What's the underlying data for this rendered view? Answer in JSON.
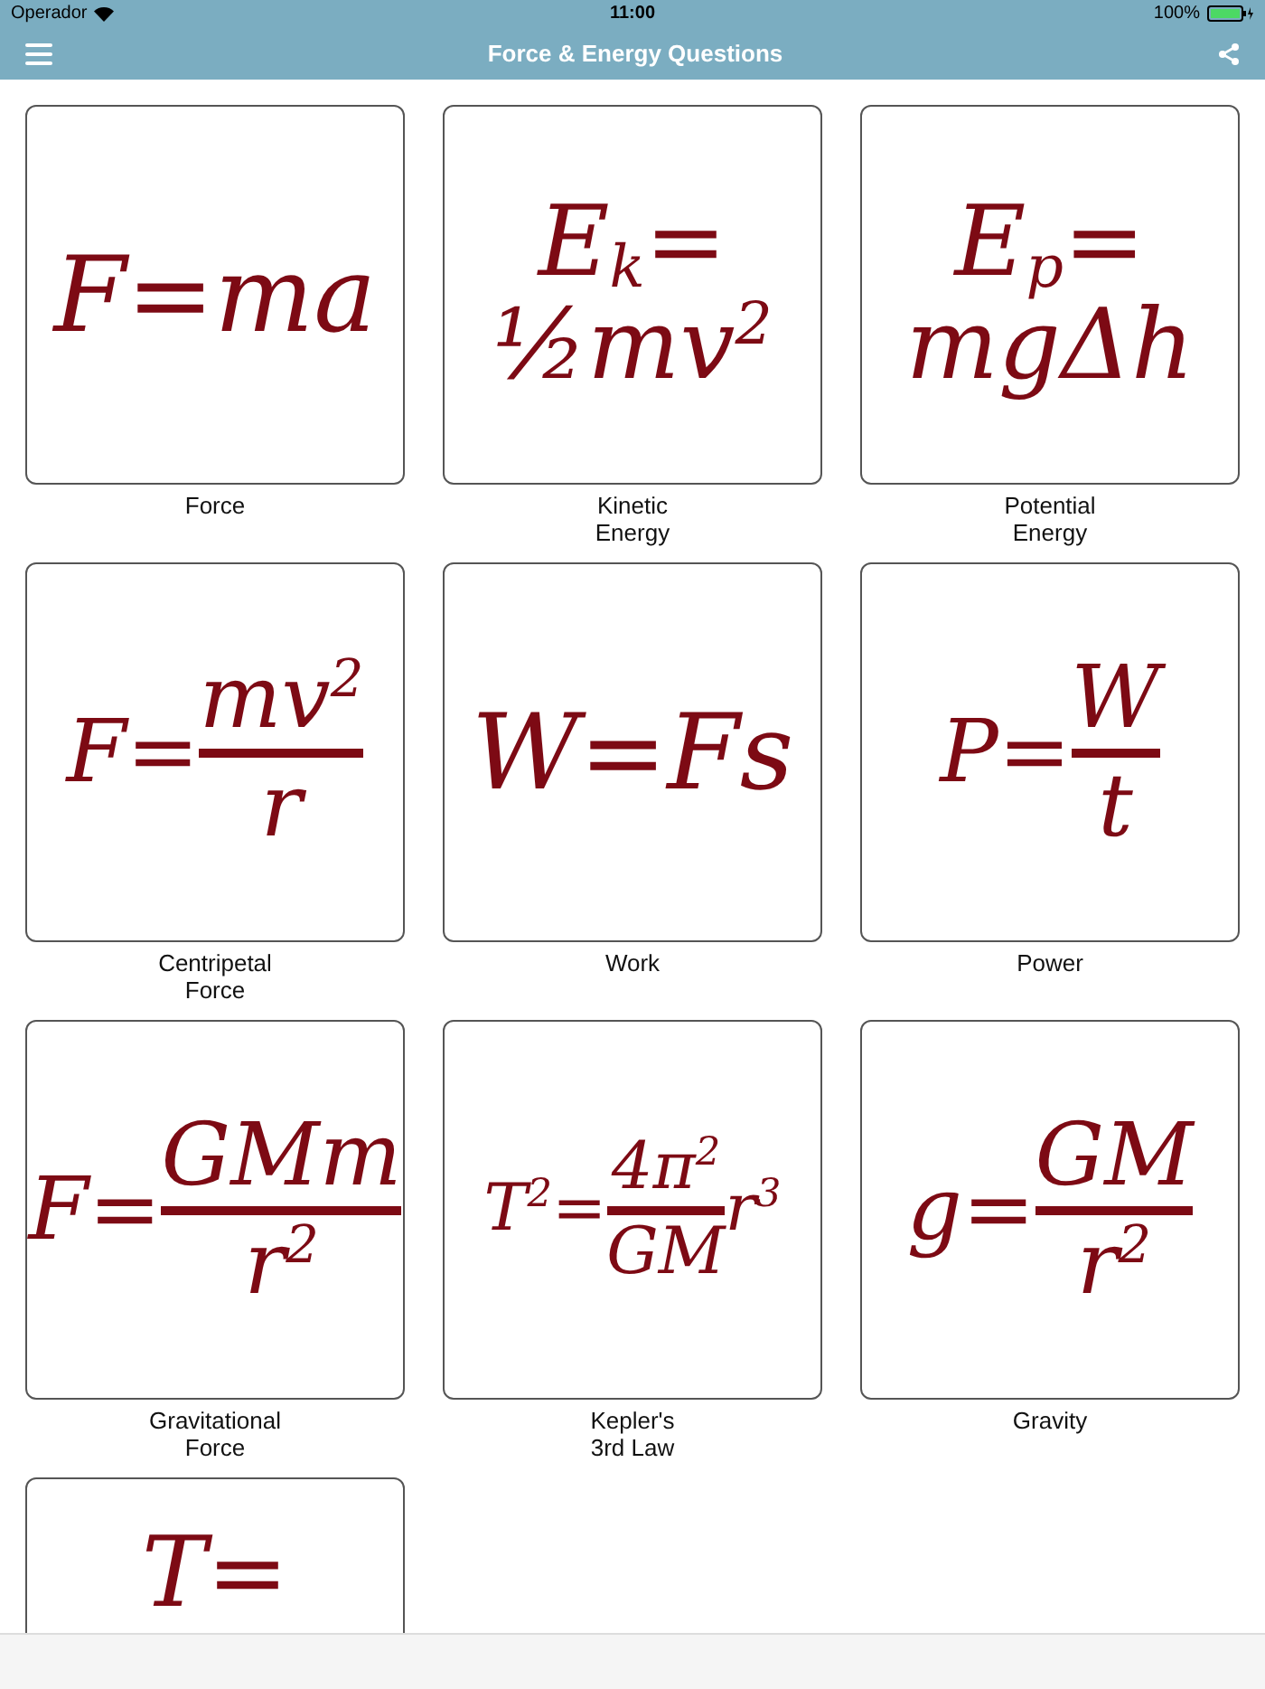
{
  "status_bar": {
    "carrier": "Operador",
    "time": "11:00",
    "battery": "100%"
  },
  "nav_bar": {
    "title": "Force & Energy Questions"
  },
  "cards": [
    {
      "label": "Force",
      "formula": {
        "kind": "inline",
        "lines": [
          "F=ma"
        ]
      }
    },
    {
      "label": "Kinetic\nEnergy",
      "formula": {
        "kind": "stacked",
        "lines": [
          "E$_{k}$=",
          "½mv$^{2}$"
        ]
      }
    },
    {
      "label": "Potential\nEnergy",
      "formula": {
        "kind": "stacked",
        "lines": [
          "E$_{p}$=",
          "mgΔh"
        ]
      }
    },
    {
      "label": "Centripetal\nForce",
      "formula": {
        "kind": "fraction",
        "lhs": "F=",
        "numerator": "mv$^{2}$",
        "denominator": "r"
      }
    },
    {
      "label": "Work",
      "formula": {
        "kind": "inline",
        "lines": [
          "W=Fs"
        ]
      }
    },
    {
      "label": "Power",
      "formula": {
        "kind": "fraction",
        "lhs": "P=",
        "numerator": "W",
        "denominator": "t"
      }
    },
    {
      "label": "Gravitational\nForce",
      "formula": {
        "kind": "fraction",
        "lhs": "F=",
        "numerator": "GMm",
        "denominator": "r$^{2}$"
      }
    },
    {
      "label": "Kepler's\n3rd Law",
      "formula": {
        "kind": "fraction",
        "lhs": "T$^{2}$=",
        "numerator": "4π$^{2}$",
        "denominator": "GM",
        "rhs": "r$^{3}$"
      }
    },
    {
      "label": "Gravity",
      "formula": {
        "kind": "fraction",
        "lhs": "g=",
        "numerator": "GM",
        "denominator": "r$^{2}$"
      }
    },
    {
      "formula": {
        "kind": "stacked",
        "lines": [
          "T="
        ]
      }
    }
  ]
}
